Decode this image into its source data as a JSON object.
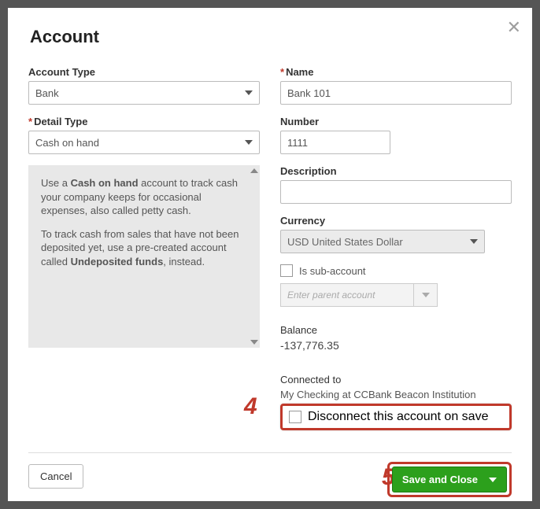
{
  "title": "Account",
  "left": {
    "account_type_label": "Account Type",
    "account_type_value": "Bank",
    "detail_type_label": "Detail Type",
    "detail_type_value": "Cash on hand",
    "help": {
      "p1_a": "Use a ",
      "p1_b": "Cash on hand",
      "p1_c": " account to track cash your company keeps for occasional expenses, also called petty cash.",
      "p2_a": "To track cash from sales that have not been deposited yet, use a pre-created account called ",
      "p2_b": "Undeposited funds",
      "p2_c": ", instead."
    }
  },
  "right": {
    "name_label": "Name",
    "name_value": "Bank 101",
    "number_label": "Number",
    "number_value": "1111",
    "description_label": "Description",
    "description_value": "",
    "currency_label": "Currency",
    "currency_value": "USD United States Dollar",
    "sub_label": "Is sub-account",
    "parent_placeholder": "Enter parent account",
    "balance_label": "Balance",
    "balance_value": "-137,776.35",
    "connected_label": "Connected to",
    "connected_value": "My Checking at CCBank Beacon Institution",
    "disconnect_label": "Disconnect this account on save"
  },
  "footer": {
    "cancel": "Cancel",
    "save": "Save and Close"
  },
  "annotations": {
    "four": "4",
    "five": "5"
  }
}
